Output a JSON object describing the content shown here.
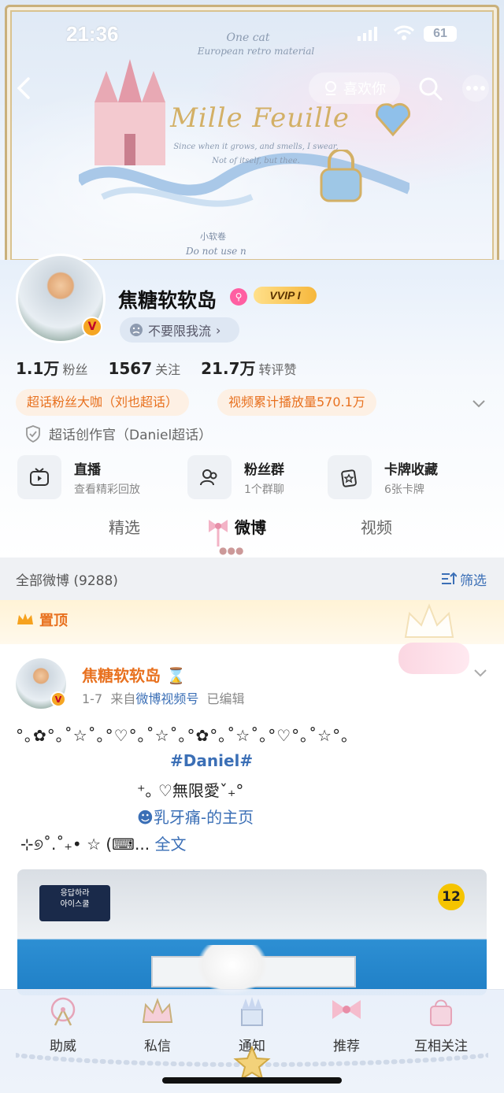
{
  "status_bar": {
    "time": "21:36",
    "battery": "61"
  },
  "banner": {
    "sub1": "One cat",
    "sub2": "European retro material",
    "title": "Mille Feuille",
    "sub3_line1": "Since when it grows, and smells, I swear,",
    "sub3_line2": "Not of itself, but thee.",
    "small": "小软卷",
    "donot": "Do not use n"
  },
  "top_nav": {
    "like_label": "喜欢你"
  },
  "profile": {
    "username": "焦糖软软岛",
    "vip": "VVIP I",
    "status": "不要限我流",
    "stats": [
      {
        "num": "1.1万",
        "label": "粉丝"
      },
      {
        "num": "1567",
        "label": "关注"
      },
      {
        "num": "21.7万",
        "label": "转评赞"
      }
    ],
    "tags": [
      "超话粉丝大咖（刘也超话）",
      "视频累计播放量570.1万"
    ],
    "creator": "超话创作官（Daniel超话）",
    "features": [
      {
        "title": "直播",
        "sub": "查看精彩回放",
        "icon": "tv-icon"
      },
      {
        "title": "粉丝群",
        "sub": "1个群聊",
        "icon": "group-icon"
      },
      {
        "title": "卡牌收藏",
        "sub": "6张卡牌",
        "icon": "card-icon"
      }
    ],
    "tabs": [
      "精选",
      "微博",
      "视频"
    ]
  },
  "filter": {
    "left": "全部微博 (9288)",
    "right": "筛选"
  },
  "pinned": {
    "label": "置顶"
  },
  "post": {
    "author": "焦糖软软岛",
    "date": "1-7",
    "from": "来自",
    "source": "微博视频号",
    "edited": "已编辑",
    "line1": "°｡✿°｡˚☆˚｡°♡°｡˚☆˚｡°✿°｡˚☆˚｡°♡°｡˚☆°｡",
    "hashtag": "#Daniel#",
    "line3": "⁺｡ ♡無限愛ˇ₊°",
    "mention": "乳牙痛-的主页",
    "line5": "⊹୭˚.˚₊• ☆ (⌨... ",
    "more": "全文",
    "video_logo_1": "응답하라",
    "video_logo_2": "아이스쿨",
    "video_rating": "12"
  },
  "bottom_nav": [
    "助威",
    "私信",
    "通知",
    "推荐",
    "互相关注"
  ],
  "colors": {
    "orange": "#e8711f",
    "blue": "#3b6fb6",
    "gold": "#d3b066"
  }
}
